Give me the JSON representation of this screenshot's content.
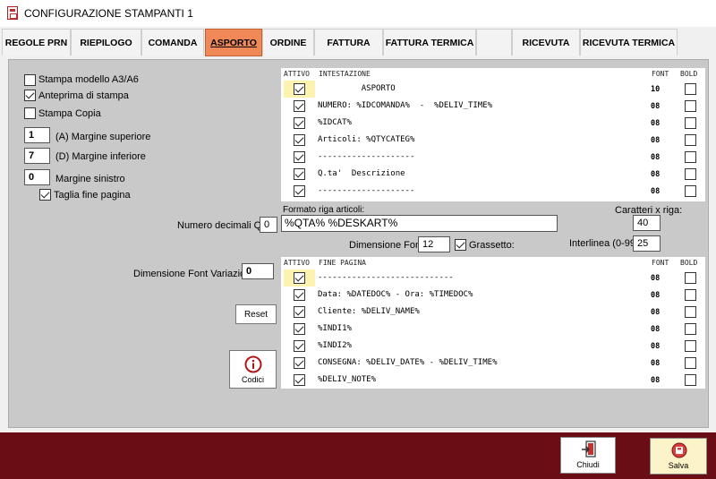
{
  "window": {
    "title": "CONFIGURAZIONE STAMPANTI 1"
  },
  "tabs": [
    {
      "label": "REGOLE PRN"
    },
    {
      "label": "RIEPILOGO"
    },
    {
      "label": "COMANDA"
    },
    {
      "label": "ASPORTO",
      "active": true
    },
    {
      "label": "ORDINE"
    },
    {
      "label": "FATTURA"
    },
    {
      "label": "FATTURA TERMICA"
    },
    {
      "label": "RICEVUTA"
    },
    {
      "label": "RICEVUTA TERMICA"
    }
  ],
  "options": {
    "stampa_modello": {
      "label": "Stampa modello A3/A6",
      "checked": false
    },
    "anteprima": {
      "label": "Anteprima di stampa",
      "checked": true
    },
    "stampa_copia": {
      "label": "Stampa Copia",
      "checked": false
    },
    "margine_superiore": {
      "value": "1",
      "label": "(A) Margine superiore"
    },
    "margine_inferiore": {
      "value": "7",
      "label": "(D) Margine inferiore"
    },
    "margine_sinistro": {
      "value": "0",
      "label": "Margine sinistro"
    },
    "taglia_fine_pagina": {
      "label": "Taglia fine pagina",
      "checked": true
    }
  },
  "intestazione": {
    "headers": {
      "attivo": "ATTIVO",
      "title": "INTESTAZIONE",
      "font": "FONT",
      "bold": "BOLD"
    },
    "rows": [
      {
        "text": "         ASPORTO",
        "font": "10",
        "active": true,
        "bold": false,
        "highlight": true
      },
      {
        "text": "NUMERO: %IDCOMANDA%  -  %DELIV_TIME%",
        "font": "08",
        "active": true,
        "bold": false
      },
      {
        "text": "%IDCAT%",
        "font": "08",
        "active": true,
        "bold": false
      },
      {
        "text": "Articoli: %QTYCATEG%",
        "font": "08",
        "active": true,
        "bold": false
      },
      {
        "text": "--------------------",
        "font": "08",
        "active": true,
        "bold": false
      },
      {
        "text": "Q.ta'  Descrizione",
        "font": "08",
        "active": true,
        "bold": false
      },
      {
        "text": "--------------------",
        "font": "08",
        "active": true,
        "bold": false
      }
    ]
  },
  "middle": {
    "decimali_label": "Numero decimali Qtà",
    "decimali_value": "0",
    "formato_label": "Formato riga articoli:",
    "formato_value": "%QTA% %DESKART%",
    "caratteri_label": "Caratteri x riga:",
    "caratteri_value": "40",
    "dim_font_label": "Dimensione Font:",
    "dim_font_value": "12",
    "grassetto_label": "Grassetto:",
    "grassetto_checked": true,
    "interlinea_label": "Interlinea (0-99)",
    "interlinea_value": "25",
    "dim_font_var_label": "Dimensione Font Variazioni:",
    "dim_font_var_value": "0"
  },
  "fine_pagina": {
    "headers": {
      "attivo": "ATTIVO",
      "title": "FINE PAGINA",
      "font": "FONT",
      "bold": "BOLD"
    },
    "rows": [
      {
        "text": "----------------------------",
        "font": "08",
        "active": true,
        "bold": false,
        "highlight": true
      },
      {
        "text": "Data: %DATEDOC% - Ora: %TIMEDOC%",
        "font": "08",
        "active": true,
        "bold": false
      },
      {
        "text": "Cliente: %DELIV_NAME%",
        "font": "08",
        "active": true,
        "bold": false
      },
      {
        "text": "%INDI1%",
        "font": "08",
        "active": true,
        "bold": false
      },
      {
        "text": "%INDI2%",
        "font": "08",
        "active": true,
        "bold": false
      },
      {
        "text": "CONSEGNA: %DELIV_DATE% - %DELIV_TIME%",
        "font": "08",
        "active": true,
        "bold": false
      },
      {
        "text": "%DELIV_NOTE%",
        "font": "08",
        "active": true,
        "bold": false
      }
    ]
  },
  "buttons": {
    "reset": "Reset",
    "codici": "Codici",
    "chiudi": "Chiudi",
    "salva": "Salva"
  },
  "colors": {
    "active_tab": "#f08858",
    "bottom_bar": "#6b0d14",
    "row_highlight": "#fdf2b0"
  }
}
